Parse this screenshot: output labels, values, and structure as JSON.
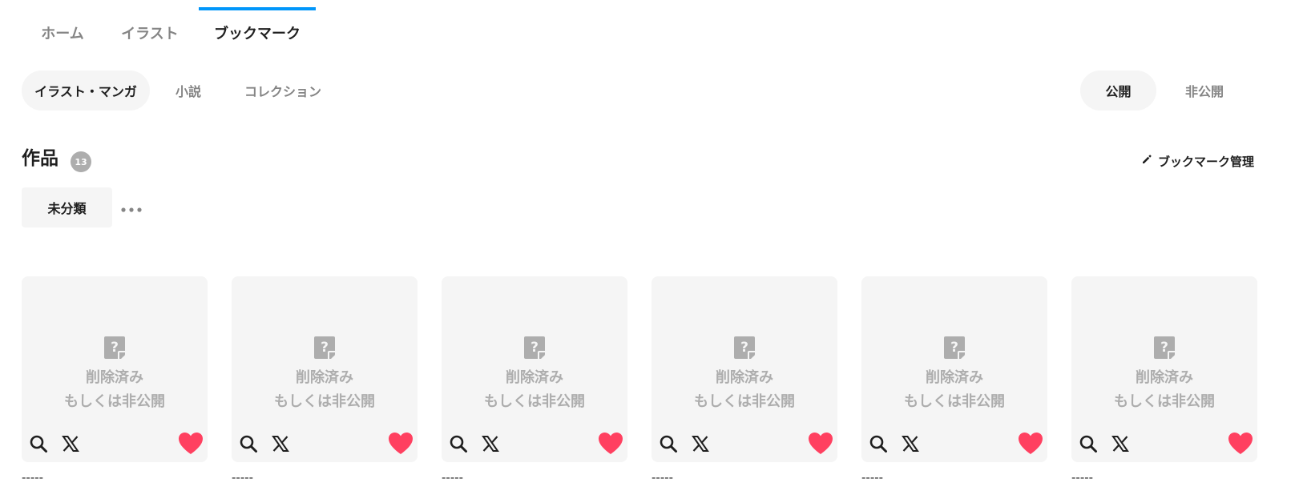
{
  "top_tabs": [
    {
      "label": "ホーム",
      "active": false
    },
    {
      "label": "イラスト",
      "active": false
    },
    {
      "label": "ブックマーク",
      "active": true
    }
  ],
  "content_type_tabs": [
    {
      "label": "イラスト・マンガ",
      "active": true
    },
    {
      "label": "小説",
      "active": false
    },
    {
      "label": "コレクション",
      "active": false
    }
  ],
  "visibility_tabs": [
    {
      "label": "公開",
      "active": true
    },
    {
      "label": "非公開",
      "active": false
    }
  ],
  "section": {
    "title": "作品",
    "count": "13",
    "manage_label": "ブックマーク管理",
    "manage_icon": "pencil-icon"
  },
  "tags": {
    "selected": "未分類",
    "more_icon": "ellipsis-icon"
  },
  "works": [
    {
      "status_line1": "削除済み",
      "status_line2": "もしくは非公開",
      "title": "-----",
      "bookmarked": true
    },
    {
      "status_line1": "削除済み",
      "status_line2": "もしくは非公開",
      "title": "-----",
      "bookmarked": true
    },
    {
      "status_line1": "削除済み",
      "status_line2": "もしくは非公開",
      "title": "-----",
      "bookmarked": true
    },
    {
      "status_line1": "削除済み",
      "status_line2": "もしくは非公開",
      "title": "-----",
      "bookmarked": true
    },
    {
      "status_line1": "削除済み",
      "status_line2": "もしくは非公開",
      "title": "-----",
      "bookmarked": true
    },
    {
      "status_line1": "削除済み",
      "status_line2": "もしくは非公開",
      "title": "-----",
      "bookmarked": true
    }
  ],
  "colors": {
    "accent": "#0096fa",
    "heart": "#ff4060",
    "placeholder_bg": "#f5f5f5",
    "muted_text": "#adadad"
  }
}
